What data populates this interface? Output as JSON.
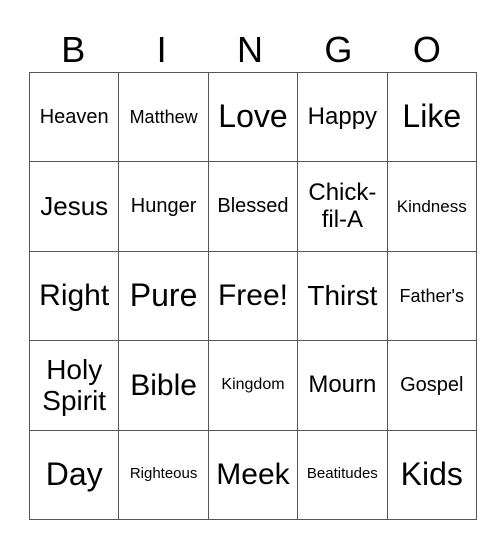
{
  "header": [
    "B",
    "I",
    "N",
    "G",
    "O"
  ],
  "cells": [
    [
      "Heaven",
      "Matthew",
      "Love",
      "Happy",
      "Like"
    ],
    [
      "Jesus",
      "Hunger",
      "Blessed",
      "Chick-fil-A",
      "Kindness"
    ],
    [
      "Right",
      "Pure",
      "Free!",
      "Thirst",
      "Father's"
    ],
    [
      "Holy Spirit",
      "Bible",
      "Kingdom",
      "Mourn",
      "Gospel"
    ],
    [
      "Day",
      "Righteous",
      "Meek",
      "Beatitudes",
      "Kids"
    ]
  ]
}
